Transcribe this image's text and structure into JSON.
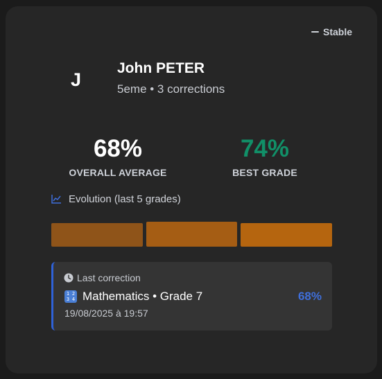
{
  "trend": {
    "label": "Stable",
    "icon": "minus-icon"
  },
  "student": {
    "initial": "J",
    "name": "John PETER",
    "subtitle": "5eme • 3 corrections"
  },
  "stats": {
    "average_value": "68%",
    "average_label": "OVERALL AVERAGE",
    "best_value": "74%",
    "best_label": "BEST GRADE",
    "best_color": "#119068"
  },
  "evolution": {
    "title": "Evolution (last 5 grades)",
    "icon": "line-chart-icon",
    "bars": [
      {
        "color": "#8f5419"
      },
      {
        "color": "#a55d14"
      },
      {
        "color": "#b5650f"
      }
    ]
  },
  "last_correction": {
    "header": "Last correction",
    "icon": "clock-icon",
    "subject_icon": "numbers-icon",
    "subject": "Mathematics • Grade 7",
    "date": "19/08/2025 à 19:57",
    "grade": "68%",
    "accent_color": "#2f62d8"
  }
}
